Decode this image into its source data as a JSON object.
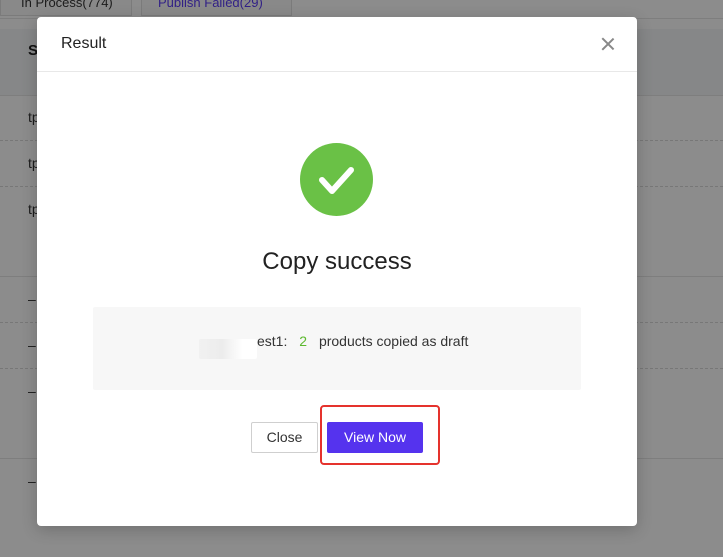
{
  "background": {
    "tabs": [
      {
        "label": "In Process(774)"
      },
      {
        "label": "Publish Failed(29)"
      }
    ],
    "table": {
      "header_label": "S",
      "rows": [
        {
          "cell": "tp"
        },
        {
          "cell": "tp"
        },
        {
          "cell": "tp"
        },
        {
          "cell": "–"
        },
        {
          "cell": "–"
        },
        {
          "cell": "–"
        },
        {
          "cell": "–"
        }
      ]
    }
  },
  "modal": {
    "title": "Result",
    "status_icon": "check-icon",
    "result_title": "Copy success",
    "info": {
      "store_suffix": "est1:",
      "count": "2",
      "message": "products copied as draft"
    },
    "buttons": {
      "close_label": "Close",
      "view_label": "View Now"
    }
  },
  "colors": {
    "accent": "#5533ee",
    "success": "#6ac146",
    "count_text": "#5cb82e",
    "highlight": "#e5322d"
  }
}
